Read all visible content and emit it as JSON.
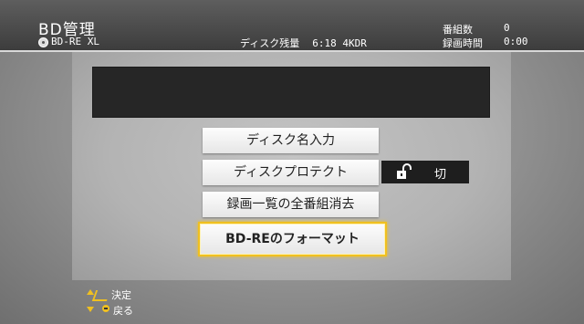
{
  "header": {
    "title": "BD管理",
    "disc_icon": "disc-icon",
    "disc_type": "BD-RE XL",
    "remaining_label": "ディスク残量",
    "remaining_value": "6:18 4KDR",
    "program_count_label": "番組数",
    "program_count_value": "0",
    "recording_time_label": "録画時間",
    "recording_time_value": "0:00"
  },
  "menu": {
    "items": [
      {
        "label": "ディスク名入力"
      },
      {
        "label": "ディスクプロテクト"
      },
      {
        "label": "録画一覧の全番組消去"
      },
      {
        "label": "BD-REのフォーマット",
        "selected": true
      }
    ],
    "protect_status": {
      "icon": "unlocked-padlock-icon",
      "value": "切"
    }
  },
  "hints": {
    "decide": "決定",
    "back": "戻る"
  },
  "colors": {
    "highlight": "#f0c020",
    "header_bg": "#4a4a4a",
    "panel_bg": "#b8b8b8"
  }
}
